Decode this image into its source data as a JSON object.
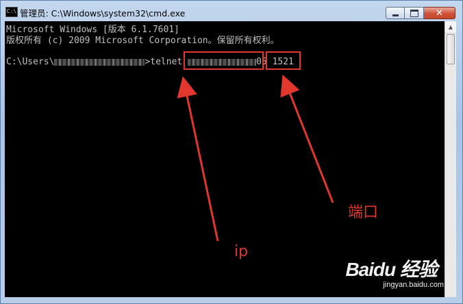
{
  "window": {
    "title": "管理员: C:\\Windows\\system32\\cmd.exe",
    "app_icon": "cmd-icon",
    "icon_text": "C:\\",
    "buttons": [
      "minimize-icon",
      "maximize-icon",
      "close-icon"
    ],
    "close_glyph": "✕"
  },
  "console": {
    "line1": "Microsoft Windows [版本 6.1.7601]",
    "line2": "版权所有 (c) 2009 Microsoft Corporation。保留所有权利。",
    "prompt_prefix": "C:\\Users\\",
    "prompt_suffix": ">telnet ",
    "ip_tail": "05",
    "port": "1521"
  },
  "annotations": {
    "ip_label": "ip",
    "port_label": "端口",
    "accent_color": "#e2372d"
  },
  "watermark": {
    "brand": "Baidu 经验",
    "url": "jingyan.baidu.com"
  }
}
